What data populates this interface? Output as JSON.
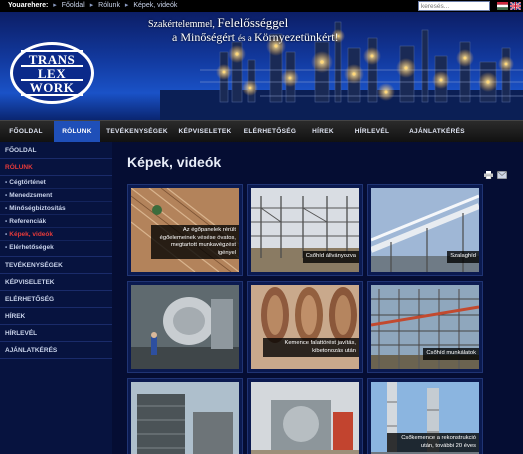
{
  "breadcrumb": {
    "label": "Youarehere:",
    "items": [
      "Főoldal",
      "Rólunk",
      "Képek, videók"
    ]
  },
  "search": {
    "placeholder": "keresés..."
  },
  "banner": {
    "logo_lines": [
      "TRANS",
      "LEX",
      "WORK"
    ],
    "slogan_line1_a": "Szakértelemmel, ",
    "slogan_line1_b": "Felelősséggel",
    "slogan_line2_a": "a Minőségért ",
    "slogan_line2_b": "és a ",
    "slogan_line2_c": "Környezetünkért!"
  },
  "nav": [
    "FŐOLDAL",
    "RÓLUNK",
    "TEVÉKENYSÉGEK",
    "KÉPVISELETEK",
    "ELÉRHETŐSÉG",
    "HÍREK",
    "HÍRLEVÉL",
    "AJÁNLATKÉRÉS"
  ],
  "sidebar": {
    "top1": "FŐOLDAL",
    "top2": "RÓLUNK",
    "subitems": [
      "Cégtörténet",
      "Menedzsment",
      "Minőségbiztosítás",
      "Referenciák",
      "Képek, videók",
      "Elérhetőségek"
    ],
    "bottom": [
      "TEVÉKENYSÉGEK",
      "KÉPVISELETEK",
      "ELÉRHETŐSÉG",
      "HÍREK",
      "HÍRLEVÉL",
      "AJÁNLATKÉRÉS"
    ]
  },
  "main": {
    "title": "Képek, videók",
    "captions": [
      [
        "Az égőpanelek rérült",
        "égőelemeinek vésése óvatos,",
        "megtartott munkavégzést igényel"
      ],
      [
        "Csőhíd állványozva"
      ],
      [
        "Szalaghíd"
      ],
      [],
      [
        "Kemence falattörést javítás,",
        "kibetonozás után"
      ],
      [
        "Csőhíd munkálatok"
      ],
      [],
      [],
      [
        "Csőkemence a rekonstrukció",
        "után, további 20 éves"
      ]
    ]
  },
  "colors": {
    "background": "#050d33",
    "nav_active": "#1f4fb8",
    "sidebar_active": "#e53a3a",
    "banner_blue": "#123aa0"
  }
}
